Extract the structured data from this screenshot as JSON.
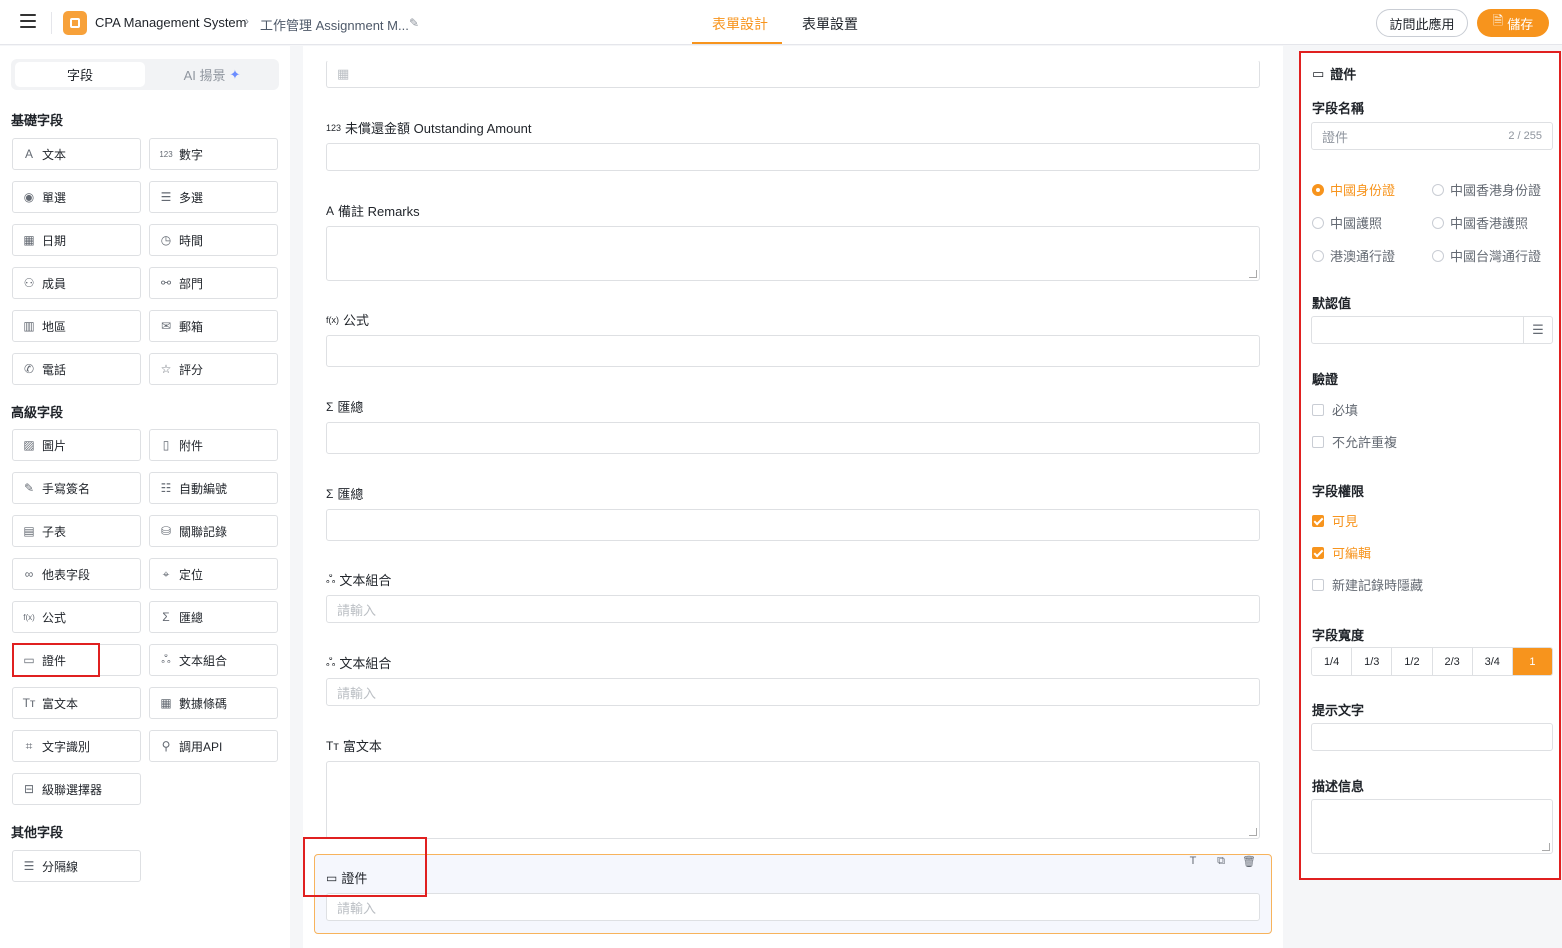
{
  "topbar": {
    "app_name": "CPA Management System",
    "breadcrumb_sep": "›",
    "page_name": "工作管理 Assignment M...",
    "tabs": [
      "表單設計",
      "表單設置"
    ],
    "visit_label": "訪問此應用",
    "save_label": "儲存"
  },
  "left": {
    "seg_fields": "字段",
    "seg_ai": "AI 揚景",
    "sections": {
      "basic": "基礎字段",
      "advanced": "高級字段",
      "other": "其他字段"
    },
    "basic_fields": [
      {
        "label": "文本",
        "icon": "text-icon",
        "glyph": "A"
      },
      {
        "label": "數字",
        "icon": "number-icon",
        "glyph": "123"
      },
      {
        "label": "單選",
        "icon": "radio-icon",
        "glyph": "◉"
      },
      {
        "label": "多選",
        "icon": "checklist-icon",
        "glyph": "☰"
      },
      {
        "label": "日期",
        "icon": "calendar-icon",
        "glyph": "▦"
      },
      {
        "label": "時間",
        "icon": "clock-icon",
        "glyph": "◷"
      },
      {
        "label": "成員",
        "icon": "user-icon",
        "glyph": "⚇"
      },
      {
        "label": "部門",
        "icon": "org-icon",
        "glyph": "⚯"
      },
      {
        "label": "地區",
        "icon": "map-icon",
        "glyph": "▥"
      },
      {
        "label": "郵箱",
        "icon": "mail-icon",
        "glyph": "✉"
      },
      {
        "label": "電話",
        "icon": "phone-icon",
        "glyph": "✆"
      },
      {
        "label": "評分",
        "icon": "star-icon",
        "glyph": "☆"
      }
    ],
    "advanced_fields": [
      {
        "label": "圖片",
        "icon": "image-icon",
        "glyph": "▨"
      },
      {
        "label": "附件",
        "icon": "file-icon",
        "glyph": "▯"
      },
      {
        "label": "手寫簽名",
        "icon": "pen-icon",
        "glyph": "✎"
      },
      {
        "label": "自動編號",
        "icon": "numbered-list-icon",
        "glyph": "☷"
      },
      {
        "label": "子表",
        "icon": "table-icon",
        "glyph": "▤"
      },
      {
        "label": "關聯記錄",
        "icon": "database-icon",
        "glyph": "⛁"
      },
      {
        "label": "他表字段",
        "icon": "link-icon",
        "glyph": "∞"
      },
      {
        "label": "定位",
        "icon": "location-icon",
        "glyph": "⌖"
      },
      {
        "label": "公式",
        "icon": "formula-icon",
        "glyph": "f(x)"
      },
      {
        "label": "匯總",
        "icon": "sigma-icon",
        "glyph": "Σ"
      },
      {
        "label": "證件",
        "icon": "id-card-icon",
        "glyph": "▭"
      },
      {
        "label": "文本組合",
        "icon": "combine-icon",
        "glyph": "ஃ"
      },
      {
        "label": "富文本",
        "icon": "rich-text-icon",
        "glyph": "Tт"
      },
      {
        "label": "數據條碼",
        "icon": "qrcode-icon",
        "glyph": "▦"
      },
      {
        "label": "文字識別",
        "icon": "scan-icon",
        "glyph": "⌗"
      },
      {
        "label": "調用API",
        "icon": "api-icon",
        "glyph": "⚲"
      },
      {
        "label": "級聯選擇器",
        "icon": "cascade-icon",
        "glyph": "⊟"
      }
    ],
    "other_fields": [
      {
        "label": "分隔線",
        "icon": "divider-icon",
        "glyph": "☰"
      }
    ]
  },
  "canvas": {
    "fields": [
      {
        "label": "未償還金額 Outstanding Amount",
        "glyph": "123"
      },
      {
        "label": "備註 Remarks",
        "glyph": "A"
      },
      {
        "label": "公式",
        "glyph": "f(x)"
      },
      {
        "label": "匯總",
        "glyph": "Σ"
      },
      {
        "label": "匯總",
        "glyph": "Σ"
      },
      {
        "label": "文本組合",
        "glyph": "ஃ"
      },
      {
        "label": "文本組合",
        "glyph": "ஃ"
      },
      {
        "label": "富文本",
        "glyph": "Tт"
      },
      {
        "label": "證件",
        "glyph": "▭"
      }
    ],
    "placeholder": "請輸入",
    "selected_field_tools": [
      "T",
      "⧉",
      "🗑"
    ]
  },
  "props": {
    "title": "證件",
    "field_name_label": "字段名稱",
    "field_name_value": "證件",
    "field_name_counter": "2 / 255",
    "id_types": [
      {
        "label": "中國身份證",
        "selected": true
      },
      {
        "label": "中國香港身份證",
        "selected": false
      },
      {
        "label": "中國護照",
        "selected": false
      },
      {
        "label": "中國香港護照",
        "selected": false
      },
      {
        "label": "港澳通行證",
        "selected": false
      },
      {
        "label": "中國台灣通行證",
        "selected": false
      }
    ],
    "default_label": "默認值",
    "validation_label": "驗證",
    "validation": [
      {
        "label": "必填",
        "checked": false
      },
      {
        "label": "不允許重複",
        "checked": false
      }
    ],
    "permission_label": "字段權限",
    "permissions": [
      {
        "label": "可見",
        "checked": true
      },
      {
        "label": "可編輯",
        "checked": true
      },
      {
        "label": "新建記錄時隱藏",
        "checked": false
      }
    ],
    "width_label": "字段寬度",
    "widths": [
      "1/4",
      "1/3",
      "1/2",
      "2/3",
      "3/4",
      "1"
    ],
    "selected_width": "1",
    "hint_label": "提示文字",
    "desc_label": "描述信息"
  },
  "colors": {
    "accent": "#f7941d",
    "highlight": "#e02020"
  }
}
